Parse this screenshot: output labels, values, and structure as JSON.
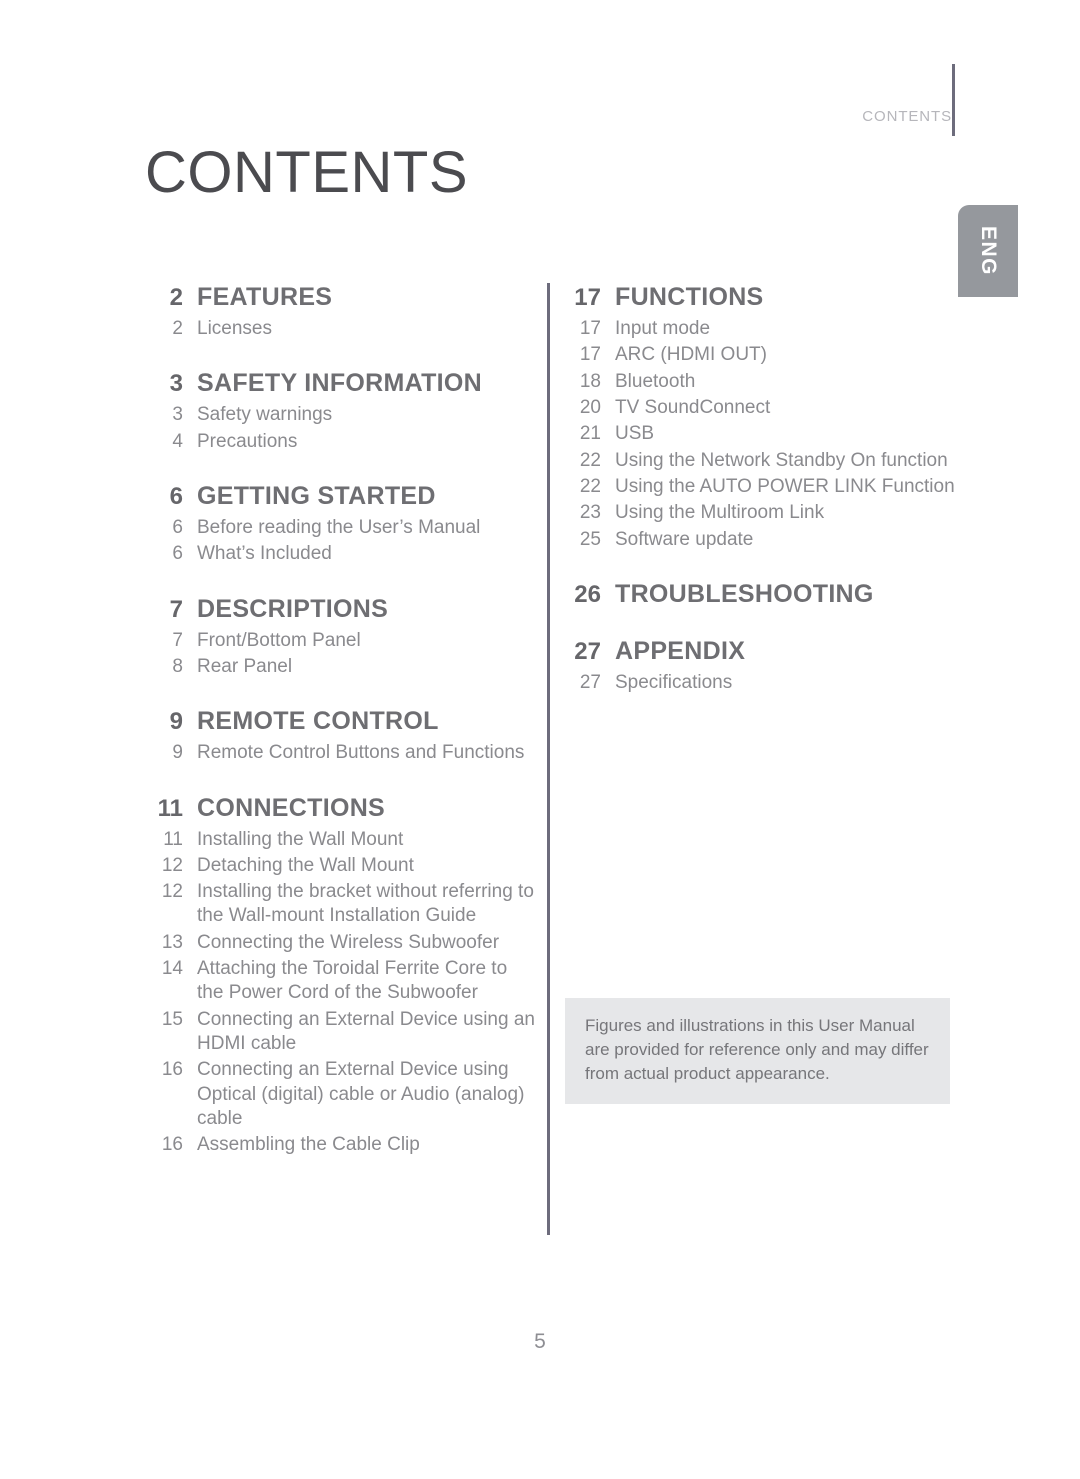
{
  "header": {
    "running_title": "CONTENTS",
    "side_tab_label": "ENG"
  },
  "page_title": "CONTENTS",
  "footer": {
    "page_number": "5"
  },
  "note": {
    "text": "Figures and illustrations in this User Manual are provided for reference only and may differ from actual product appearance."
  },
  "colors": {
    "heading": "#6e6e72",
    "entry": "#8a8a8e",
    "rule": "#6d6c7c",
    "tab_bg": "#95989d",
    "note_bg": "#e6e7e9"
  },
  "toc": {
    "left_column": [
      {
        "page": "2",
        "title": "FEATURES",
        "entries": [
          {
            "page": "2",
            "label": "Licenses"
          }
        ]
      },
      {
        "page": "3",
        "title": "SAFETY INFORMATION",
        "entries": [
          {
            "page": "3",
            "label": "Safety warnings"
          },
          {
            "page": "4",
            "label": "Precautions"
          }
        ]
      },
      {
        "page": "6",
        "title": "GETTING STARTED",
        "entries": [
          {
            "page": "6",
            "label": "Before reading the User’s Manual"
          },
          {
            "page": "6",
            "label": "What’s Included"
          }
        ]
      },
      {
        "page": "7",
        "title": "DESCRIPTIONS",
        "entries": [
          {
            "page": "7",
            "label": "Front/Bottom Panel"
          },
          {
            "page": "8",
            "label": "Rear Panel"
          }
        ]
      },
      {
        "page": "9",
        "title": "REMOTE CONTROL",
        "entries": [
          {
            "page": "9",
            "label": "Remote Control Buttons and Functions"
          }
        ]
      },
      {
        "page": "11",
        "title": "CONNECTIONS",
        "entries": [
          {
            "page": "11",
            "label": "Installing the Wall Mount"
          },
          {
            "page": "12",
            "label": "Detaching the Wall Mount"
          },
          {
            "page": "12",
            "label": "Installing the bracket without referring to the Wall-mount Installation Guide"
          },
          {
            "page": "13",
            "label": "Connecting the Wireless Subwoofer"
          },
          {
            "page": "14",
            "label": "Attaching the Toroidal Ferrite Core to the Power Cord of the Subwoofer"
          },
          {
            "page": "15",
            "label": "Connecting an External Device using an HDMI cable"
          },
          {
            "page": "16",
            "label": "Connecting an External Device using Optical (digital) cable or Audio (analog) cable"
          },
          {
            "page": "16",
            "label": "Assembling the Cable Clip"
          }
        ]
      }
    ],
    "right_column": [
      {
        "page": "17",
        "title": "FUNCTIONS",
        "entries": [
          {
            "page": "17",
            "label": "Input mode"
          },
          {
            "page": "17",
            "label": "ARC (HDMI OUT)"
          },
          {
            "page": "18",
            "label": "Bluetooth"
          },
          {
            "page": "20",
            "label": "TV SoundConnect"
          },
          {
            "page": "21",
            "label": "USB"
          },
          {
            "page": "22",
            "label": "Using the Network Standby On function"
          },
          {
            "page": "22",
            "label": "Using the AUTO POWER LINK Function"
          },
          {
            "page": "23",
            "label": "Using the Multiroom Link"
          },
          {
            "page": "25",
            "label": "Software update"
          }
        ]
      },
      {
        "page": "26",
        "title": "TROUBLESHOOTING",
        "entries": []
      },
      {
        "page": "27",
        "title": "APPENDIX",
        "entries": [
          {
            "page": "27",
            "label": "Specifications"
          }
        ]
      }
    ]
  }
}
